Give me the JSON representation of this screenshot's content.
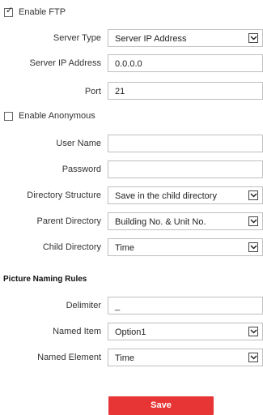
{
  "enable_ftp": {
    "label": "Enable FTP",
    "checked": true
  },
  "server_type": {
    "label": "Server Type",
    "value": "Server IP Address"
  },
  "server_ip": {
    "label": "Server IP Address",
    "value": "0.0.0.0"
  },
  "port": {
    "label": "Port",
    "value": "21"
  },
  "enable_anonymous": {
    "label": "Enable Anonymous",
    "checked": false
  },
  "user_name": {
    "label": "User Name",
    "value": ""
  },
  "password": {
    "label": "Password",
    "value": ""
  },
  "directory_structure": {
    "label": "Directory Structure",
    "value": "Save in the child directory"
  },
  "parent_directory": {
    "label": "Parent Directory",
    "value": "Building No. & Unit No."
  },
  "child_directory": {
    "label": "Child Directory",
    "value": "Time"
  },
  "picture_naming": {
    "title": "Picture Naming Rules"
  },
  "delimiter": {
    "label": "Delimiter",
    "value": "_"
  },
  "named_item": {
    "label": "Named Item",
    "value": "Option1"
  },
  "named_element": {
    "label": "Named Element",
    "value": "Time"
  },
  "save_button": {
    "label": "Save"
  },
  "colors": {
    "save_button_bg": "#e73535",
    "border": "#bfbfbf"
  },
  "icons": {
    "dropdown": "chevron-down-icon",
    "check": "checkmark-icon"
  }
}
